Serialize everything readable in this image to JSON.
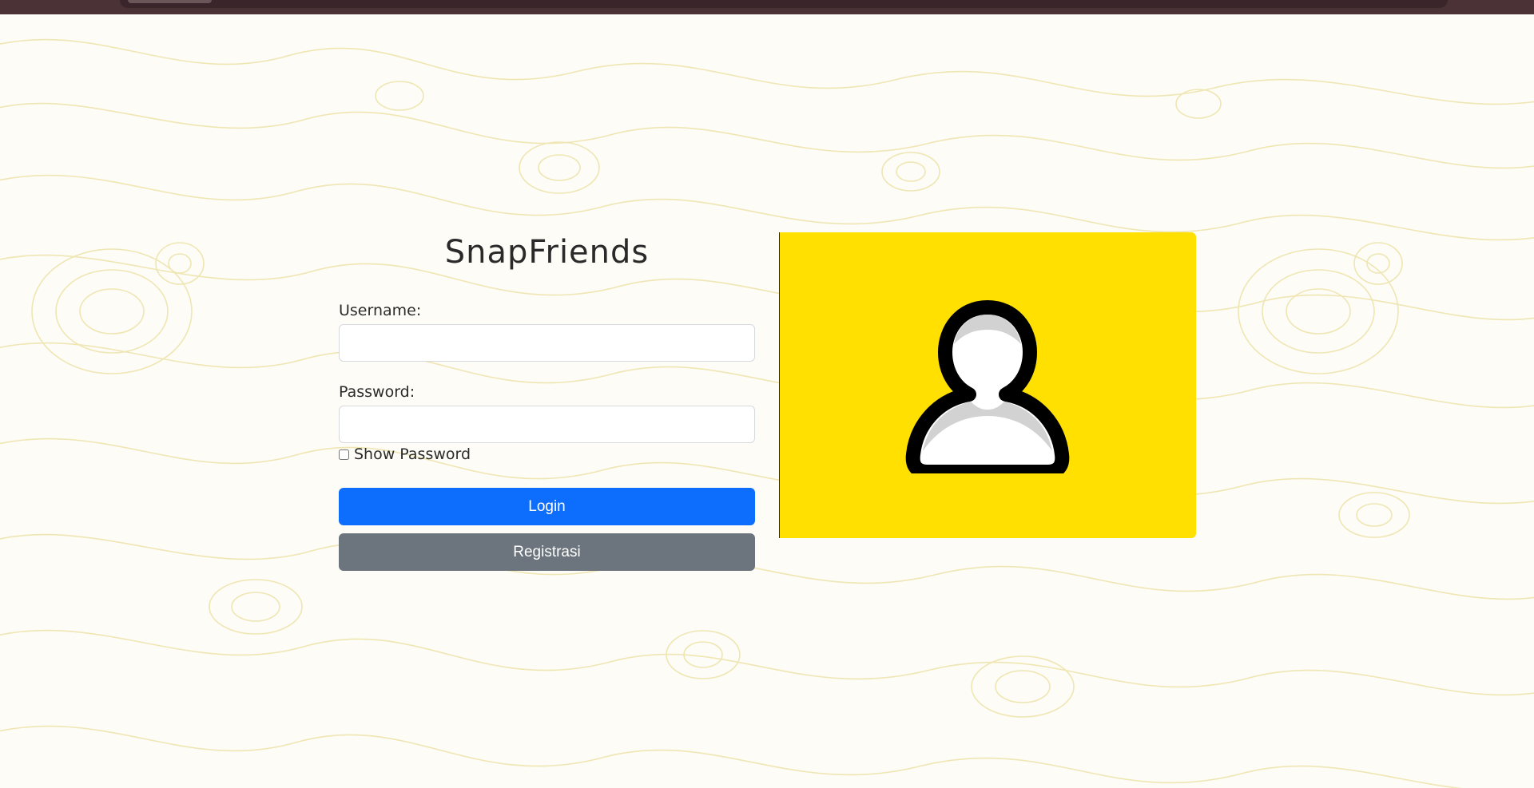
{
  "app": {
    "title": "SnapFriends"
  },
  "form": {
    "username_label": "Username:",
    "username_value": "",
    "password_label": "Password:",
    "password_value": "",
    "show_password_label": "Show Password",
    "login_button": "Login",
    "register_button": "Registrasi"
  },
  "colors": {
    "primary_button": "#0d6efd",
    "secondary_button": "#6c757d",
    "image_background": "#ffe000",
    "background_contours": "#efe6b4"
  },
  "icons": {
    "avatar": "user-silhouette-icon"
  }
}
